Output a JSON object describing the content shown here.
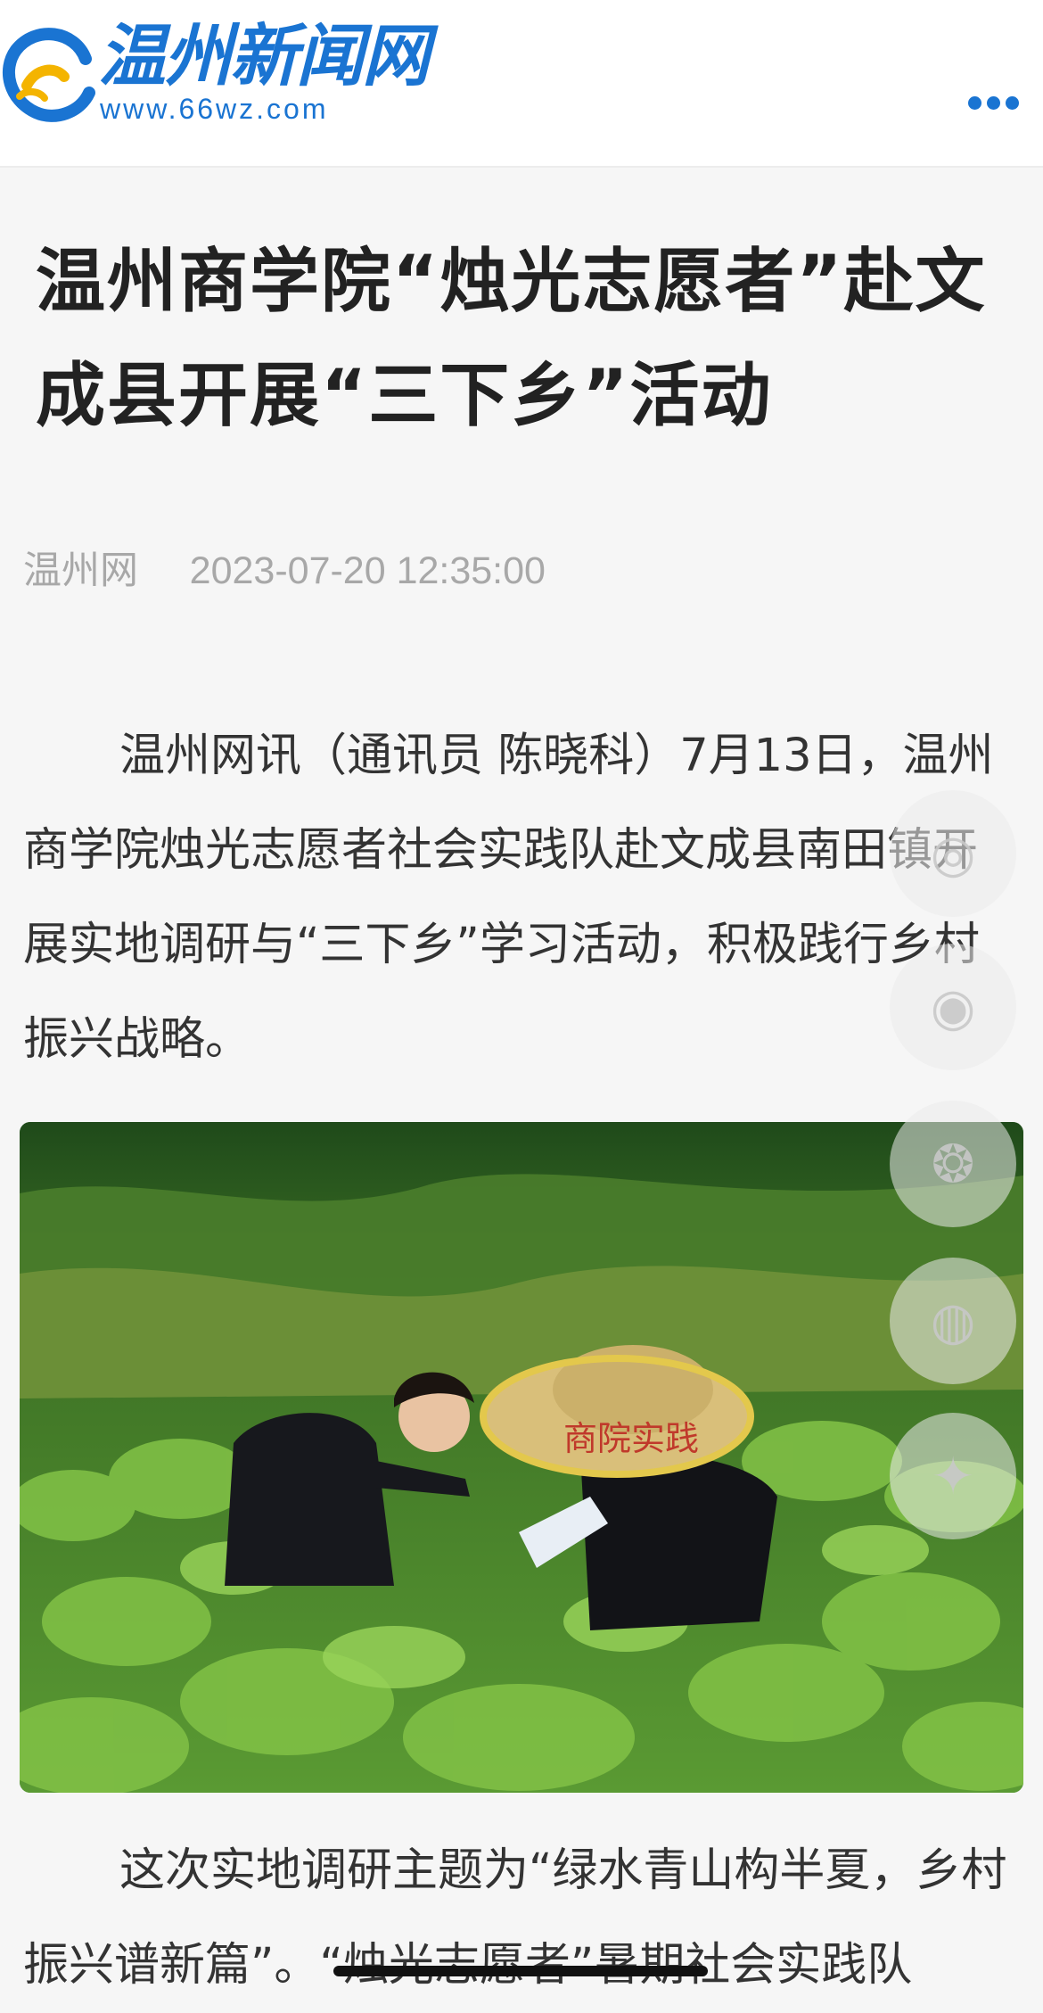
{
  "header": {
    "site_name": "温州新闻网",
    "site_url": "www.66wz.com",
    "more_icon": "more-dots-icon",
    "brand_color": "#1a74d2"
  },
  "article": {
    "title": "温州商学院“烛光志愿者”赴文成县开展“三下乡”活动",
    "source": "温州网",
    "date": "2023-07-20 12:35:00",
    "paragraphs": [
      "温州网讯（通讯员 陈晓科）7月13日，温州商学院烛光志愿者社会实践队赴文成县南田镇开展实地调研与“三下乡”学习活动，积极践行乡村振兴战略。",
      "这次实地调研主题为“绿水青山构半夏，乡村振兴谱新篇”。“烛光志愿者”暑期社会实践队"
    ],
    "photo_hat_text": "商院实践"
  },
  "share_buttons": [
    {
      "icon": "wechat-icon",
      "glyph": "◎"
    },
    {
      "icon": "weibo-icon",
      "glyph": "◉"
    },
    {
      "icon": "moments-icon",
      "glyph": "❂"
    },
    {
      "icon": "qq-icon",
      "glyph": "◍"
    },
    {
      "icon": "qzone-icon",
      "glyph": "✦"
    }
  ]
}
